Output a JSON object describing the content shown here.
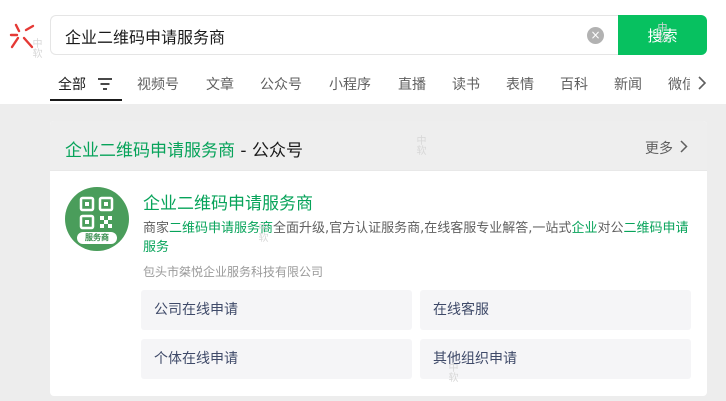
{
  "search": {
    "query": "企业二维码申请服务商",
    "button_label": "搜索",
    "clear_glyph": "×"
  },
  "tabs": [
    {
      "label": "全部",
      "active": true
    },
    {
      "label": "视频号"
    },
    {
      "label": "文章"
    },
    {
      "label": "公众号"
    },
    {
      "label": "小程序"
    },
    {
      "label": "直播"
    },
    {
      "label": "读书"
    },
    {
      "label": "表情"
    },
    {
      "label": "百科"
    },
    {
      "label": "新闻"
    },
    {
      "label": "微信"
    }
  ],
  "card": {
    "title_keyword": "企业二维码申请服务商",
    "title_suffix": " - 公众号",
    "more_label": "更多",
    "account": {
      "name": "企业二维码申请服务商",
      "avatar_label": "服务商",
      "desc_parts": [
        {
          "text": "商家",
          "hl": false
        },
        {
          "text": "二维码申请服务商",
          "hl": true
        },
        {
          "text": "全面升级,官方认证服务商,在线客服专业解答,一站式",
          "hl": false
        },
        {
          "text": "企业",
          "hl": true
        },
        {
          "text": "对公",
          "hl": false
        },
        {
          "text": "二维码申请服务",
          "hl": true
        }
      ],
      "company": "包头市桀悦企业服务科技有限公司"
    },
    "services": [
      "公司在线申请",
      "在线客服",
      "个体在线申请",
      "其他组织申请"
    ]
  },
  "icons": {
    "logo": "wechat-search-logo-icon",
    "filter": "filter-icon",
    "tabs_more": "chevron-right-icon",
    "more": "chevron-right-icon",
    "avatar": "qr-code-icon"
  },
  "colors": {
    "accent": "#07c160",
    "highlight": "#07a35a",
    "logo_red": "#e53935"
  },
  "watermark": "中软"
}
